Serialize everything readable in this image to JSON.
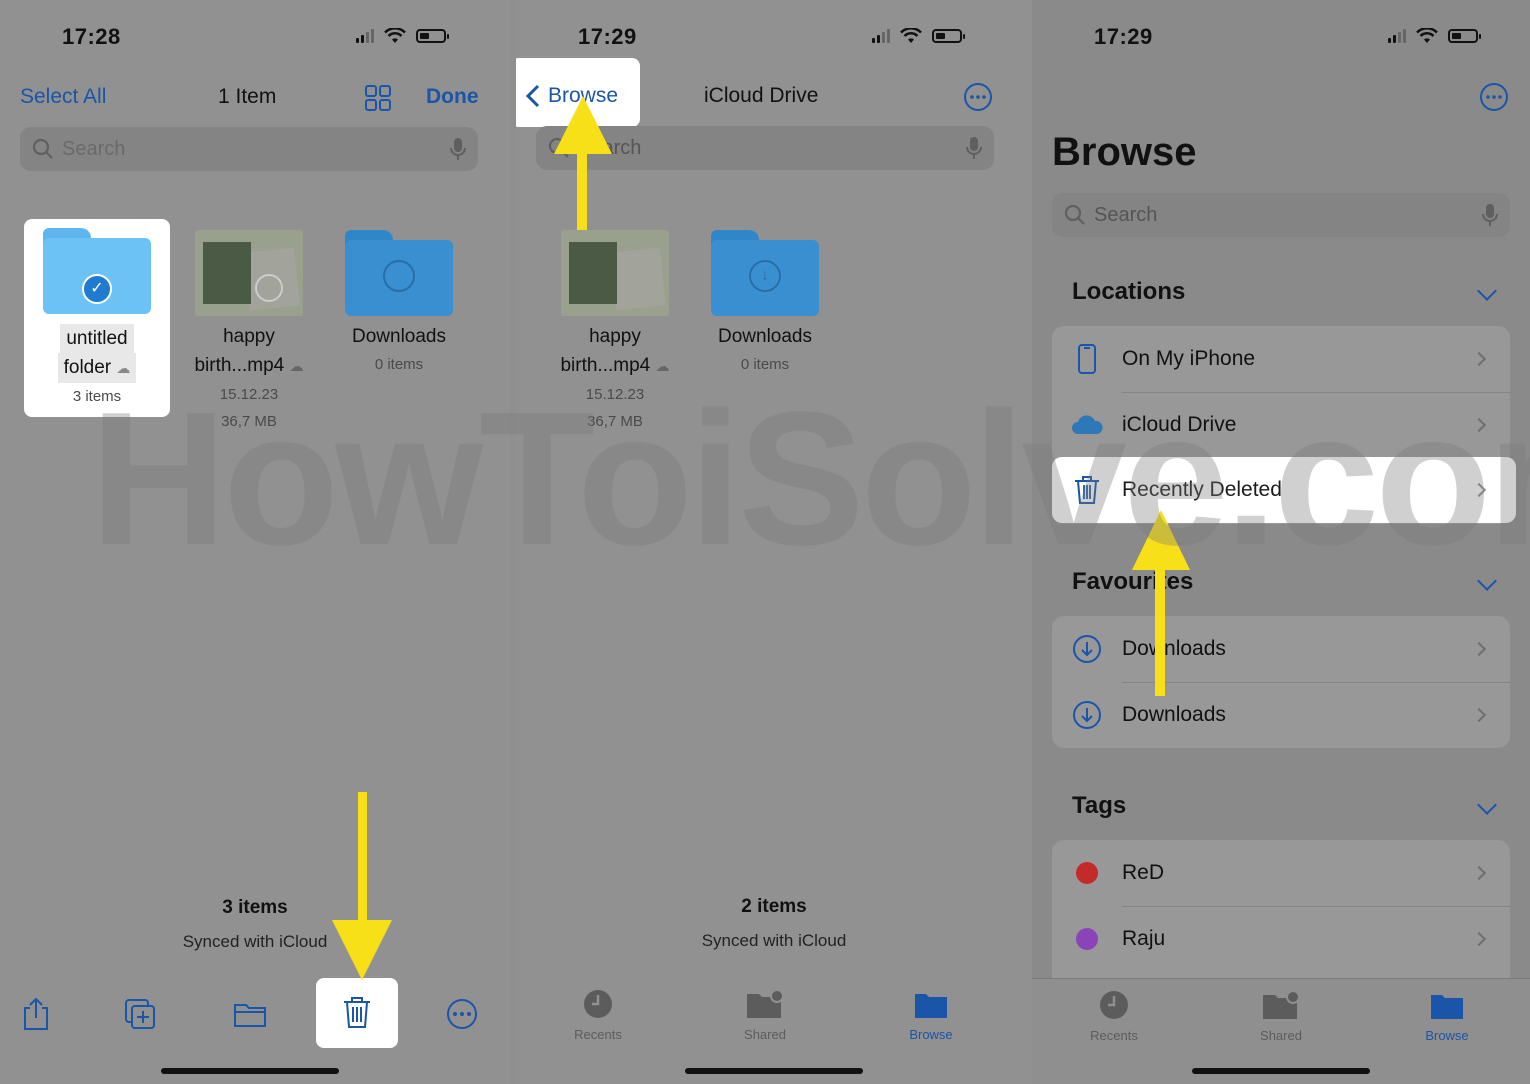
{
  "watermark": "HowToiSolve.com",
  "screen1": {
    "time": "17:28",
    "select_all": "Select All",
    "title": "1 Item",
    "done": "Done",
    "search_placeholder": "Search",
    "items": [
      {
        "name1": "untitled",
        "name2": "folder",
        "meta1": "3 items",
        "meta2": "",
        "kind": "folder-selected"
      },
      {
        "name1": "happy",
        "name2": "birth...mp4",
        "meta1": "15.12.23",
        "meta2": "36,7 MB",
        "kind": "video"
      },
      {
        "name1": "Downloads",
        "name2": "",
        "meta1": "0 items",
        "meta2": "",
        "kind": "downloads"
      }
    ],
    "footer_count": "3 items",
    "footer_sub": "Synced with iCloud"
  },
  "screen2": {
    "time": "17:29",
    "back": "Browse",
    "title": "iCloud Drive",
    "search_placeholder": "Search",
    "items": [
      {
        "name1": "happy",
        "name2": "birth...mp4",
        "meta1": "15.12.23",
        "meta2": "36,7 MB"
      },
      {
        "name1": "Downloads",
        "name2": "",
        "meta1": "0 items",
        "meta2": ""
      }
    ],
    "footer_count": "2 items",
    "footer_sub": "Synced with iCloud",
    "tabs": [
      {
        "label": "Recents",
        "active": false
      },
      {
        "label": "Shared",
        "active": false
      },
      {
        "label": "Browse",
        "active": true
      }
    ]
  },
  "screen3": {
    "time": "17:29",
    "title": "Browse",
    "search_placeholder": "Search",
    "locations_title": "Locations",
    "locations": [
      {
        "label": "On My iPhone",
        "icon": "iphone-icon"
      },
      {
        "label": "iCloud Drive",
        "icon": "icloud-icon"
      },
      {
        "label": "Recently Deleted",
        "icon": "trash-icon"
      }
    ],
    "favourites_title": "Favourites",
    "favourites": [
      {
        "label": "Downloads",
        "icon": "download-icon"
      },
      {
        "label": "Downloads",
        "icon": "download-icon"
      }
    ],
    "tags_title": "Tags",
    "tags": [
      {
        "label": "ReD",
        "color": "#c42a2a"
      },
      {
        "label": "Raju",
        "color": "#8a44b8"
      }
    ],
    "tabs": [
      {
        "label": "Recents",
        "active": false
      },
      {
        "label": "Shared",
        "active": false
      },
      {
        "label": "Browse",
        "active": true
      }
    ]
  },
  "colors": {
    "accent": "#1a55a8",
    "arrow": "#f7e017",
    "highlight": "#ffffff"
  }
}
